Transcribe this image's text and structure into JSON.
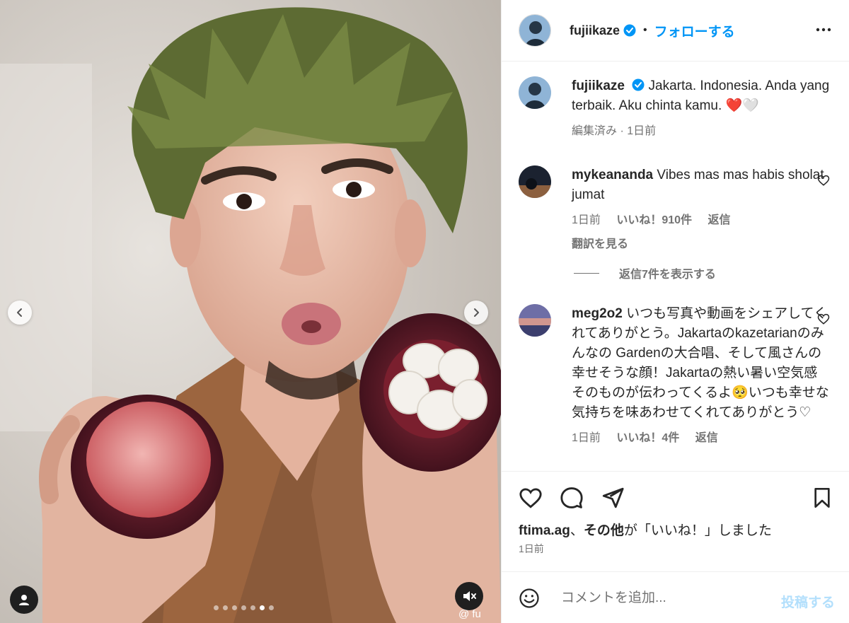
{
  "header": {
    "username": "fujiikaze",
    "separator": "•",
    "follow_label": "フォローする"
  },
  "caption": {
    "username": "fujiikaze",
    "text": "Jakarta. Indonesia. Anda yang terbaik. Aku chinta kamu. ❤️🤍",
    "edited": "編集済み · 1日前"
  },
  "comments": [
    {
      "username": "mykeananda",
      "text": "Vibes mas mas habis sholat jumat",
      "time": "1日前",
      "likes": "いいね！910件",
      "reply_label": "返信",
      "translate_label": "翻訳を見る"
    },
    {
      "username": "meg2o2",
      "text": "いつも写真や動画をシェアしてくれてありがとう。Jakartaのkazetarianのみんなの Gardenの大合唱、そして風さんの幸せそうな顔！Jakartaの熱い暑い空気感そのものが伝わってくるよ🥺いつも幸せな気持ちを味あわせてくれてありがとう♡",
      "time": "1日前",
      "likes": "いいね！4件",
      "reply_label": "返信"
    }
  ],
  "view_replies_label": "返信7件を表示する",
  "likes_summary": {
    "user": "ftima.ag",
    "joiner": "、",
    "others": "その他",
    "suffix": "が「いいね！」しました"
  },
  "post_time": "1日前",
  "comment_box": {
    "placeholder": "コメントを追加...",
    "post_label": "投稿する"
  },
  "media": {
    "watermark": "@ fu",
    "carousel_total": 7,
    "carousel_active": 6
  },
  "colors": {
    "accent": "#0095f6",
    "post_disabled": "#b2dffc",
    "muted": "#737373"
  },
  "icons": [
    "chevron-left-icon",
    "chevron-right-icon",
    "user-tag-icon",
    "muted-speaker-icon",
    "verified-badge-icon",
    "more-options-icon",
    "heart-icon",
    "comment-icon",
    "share-icon",
    "bookmark-icon",
    "emoji-icon"
  ]
}
